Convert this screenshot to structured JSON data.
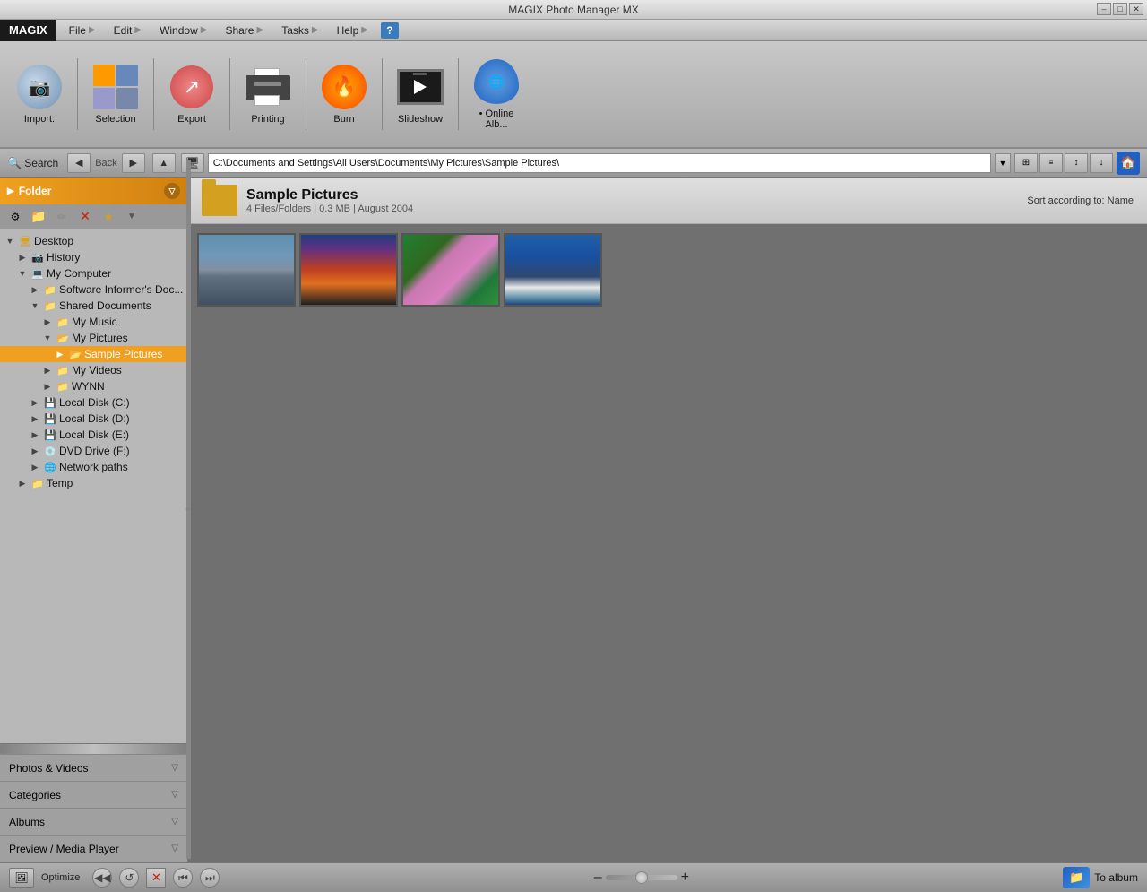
{
  "window": {
    "title": "MAGIX Photo Manager MX"
  },
  "menu": {
    "logo": "MAGIX",
    "items": [
      "File",
      "Edit",
      "Window",
      "Share",
      "Tasks",
      "Help"
    ]
  },
  "toolbar": {
    "buttons": [
      {
        "id": "import",
        "label": "Import:",
        "icon": "import-icon"
      },
      {
        "id": "selection",
        "label": "Selection",
        "icon": "selection-icon"
      },
      {
        "id": "export",
        "label": "Export",
        "icon": "export-icon"
      },
      {
        "id": "printing",
        "label": "Printing",
        "icon": "printing-icon"
      },
      {
        "id": "burn",
        "label": "Burn",
        "icon": "burn-icon"
      },
      {
        "id": "slideshow",
        "label": "Slideshow",
        "icon": "slideshow-icon"
      },
      {
        "id": "online-album",
        "label": "• Online Alb...",
        "icon": "online-album-icon"
      }
    ]
  },
  "navbar": {
    "search_label": "Search",
    "back_label": "Back",
    "address": "C:\\Documents and Settings\\All Users\\Documents\\My Pictures\\Sample Pictures\\"
  },
  "sidebar": {
    "folder_header": "Folder",
    "tree": [
      {
        "id": "desktop",
        "label": "Desktop",
        "level": 0,
        "expanded": true,
        "icon": "monitor"
      },
      {
        "id": "history",
        "label": "History",
        "level": 1,
        "expanded": false,
        "icon": "folder"
      },
      {
        "id": "my-computer",
        "label": "My Computer",
        "level": 1,
        "expanded": true,
        "icon": "computer"
      },
      {
        "id": "software-informer",
        "label": "Software Informer's Doc...",
        "level": 2,
        "expanded": false,
        "icon": "folder"
      },
      {
        "id": "shared-documents",
        "label": "Shared Documents",
        "level": 2,
        "expanded": true,
        "icon": "folder"
      },
      {
        "id": "my-music",
        "label": "My Music",
        "level": 3,
        "expanded": false,
        "icon": "folder"
      },
      {
        "id": "my-pictures",
        "label": "My Pictures",
        "level": 3,
        "expanded": true,
        "icon": "folder-open"
      },
      {
        "id": "sample-pictures",
        "label": "Sample Pictures",
        "level": 4,
        "expanded": false,
        "icon": "folder-open",
        "selected": true
      },
      {
        "id": "my-videos",
        "label": "My Videos",
        "level": 3,
        "expanded": false,
        "icon": "folder"
      },
      {
        "id": "wynn",
        "label": "WYNN",
        "level": 3,
        "expanded": false,
        "icon": "folder"
      },
      {
        "id": "local-disk-c",
        "label": "Local Disk (C:)",
        "level": 2,
        "expanded": false,
        "icon": "disk"
      },
      {
        "id": "local-disk-d",
        "label": "Local Disk (D:)",
        "level": 2,
        "expanded": false,
        "icon": "disk"
      },
      {
        "id": "local-disk-e",
        "label": "Local Disk (E:)",
        "level": 2,
        "expanded": false,
        "icon": "disk"
      },
      {
        "id": "dvd-drive-f",
        "label": "DVD Drive (F:)",
        "level": 2,
        "expanded": false,
        "icon": "dvd"
      },
      {
        "id": "network-paths",
        "label": "Network paths",
        "level": 2,
        "expanded": false,
        "icon": "network"
      },
      {
        "id": "temp",
        "label": "Temp",
        "level": 1,
        "expanded": false,
        "icon": "folder"
      }
    ],
    "panels": [
      {
        "id": "photos-videos",
        "label": "Photos & Videos"
      },
      {
        "id": "categories",
        "label": "Categories"
      },
      {
        "id": "albums",
        "label": "Albums"
      },
      {
        "id": "preview-media-player",
        "label": "Preview / Media Player"
      }
    ]
  },
  "content": {
    "folder_name": "Sample Pictures",
    "folder_info": "4 Files/Folders | 0.3 MB | August 2004",
    "sort_label": "Sort according to: Name",
    "photos": [
      {
        "id": "photo-1",
        "name": "Mountains",
        "class": "photo-mountains"
      },
      {
        "id": "photo-2",
        "name": "Sunset",
        "class": "photo-sunset"
      },
      {
        "id": "photo-3",
        "name": "Flowers",
        "class": "photo-flowers"
      },
      {
        "id": "photo-4",
        "name": "Ocean",
        "class": "photo-ocean"
      }
    ]
  },
  "statusbar": {
    "optimize_label": "Optimize",
    "to_album_label": "To album"
  }
}
